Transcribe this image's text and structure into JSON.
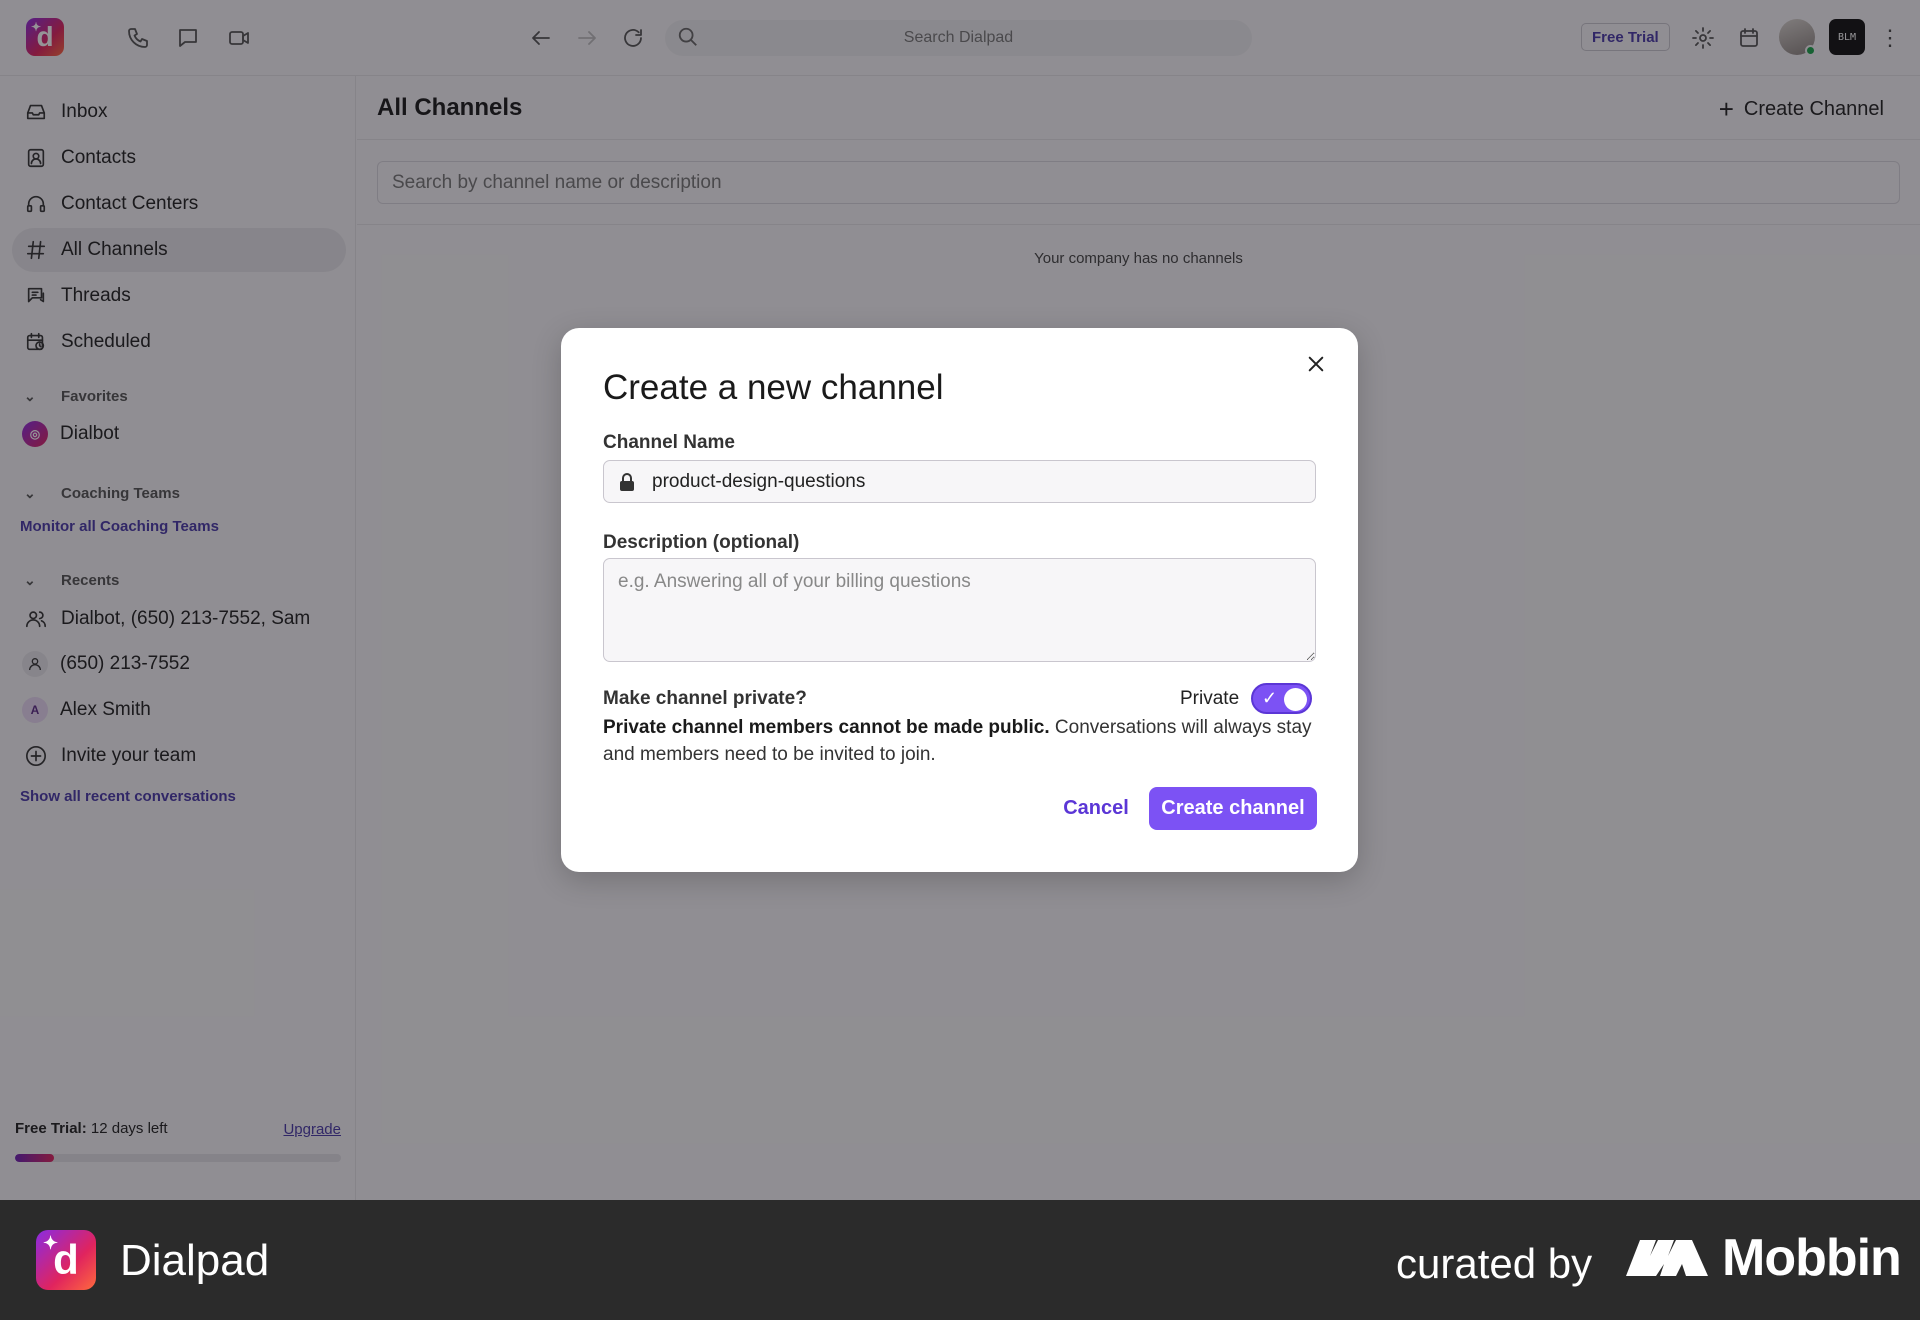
{
  "topbar": {
    "search_placeholder": "Search Dialpad",
    "free_trial_badge": "Free Trial",
    "brand_tile_text": "BLM"
  },
  "sidebar": {
    "items": [
      {
        "label": "Inbox",
        "icon": "inbox-icon"
      },
      {
        "label": "Contacts",
        "icon": "contacts-icon"
      },
      {
        "label": "Contact Centers",
        "icon": "headset-icon"
      },
      {
        "label": "All Channels",
        "icon": "hash-icon",
        "active": true
      },
      {
        "label": "Threads",
        "icon": "threads-icon"
      },
      {
        "label": "Scheduled",
        "icon": "calendar-clock-icon"
      }
    ],
    "favorites": {
      "title": "Favorites",
      "items": [
        {
          "label": "Dialbot"
        }
      ]
    },
    "coaching": {
      "title": "Coaching Teams",
      "link": "Monitor all Coaching Teams"
    },
    "recents": {
      "title": "Recents",
      "items": [
        {
          "label": "Dialbot, (650) 213-7552, Sam"
        },
        {
          "label": "(650) 213-7552"
        },
        {
          "label": "Alex Smith",
          "initial": "A"
        }
      ],
      "invite": "Invite your team",
      "link": "Show all recent conversations"
    },
    "trial": {
      "label": "Free Trial:",
      "remaining": "12 days left",
      "upgrade": "Upgrade",
      "progress": 0.12
    }
  },
  "main": {
    "title": "All Channels",
    "create_button": "Create Channel",
    "search_placeholder": "Search by channel name or description",
    "empty_message": "Your company has no channels"
  },
  "modal": {
    "title": "Create a new channel",
    "channel_name_label": "Channel Name",
    "channel_name_value": "product-design-questions",
    "description_label": "Description (optional)",
    "description_placeholder": "e.g. Answering all of your billing questions",
    "private_question": "Make channel private?",
    "private_label": "Private",
    "private_enabled": true,
    "private_note_bold": "Private channel members cannot be made public.",
    "private_note_rest": " Conversations will always stay and members need to be invited to join.",
    "cancel_label": "Cancel",
    "create_label": "Create channel"
  },
  "footer": {
    "app_name": "Dialpad",
    "curated_by": "curated by",
    "brand": "Mobbin"
  },
  "colors": {
    "accent": "#7c52f4",
    "link": "#4a3aa8",
    "footer_bg": "#2b2b2b"
  }
}
